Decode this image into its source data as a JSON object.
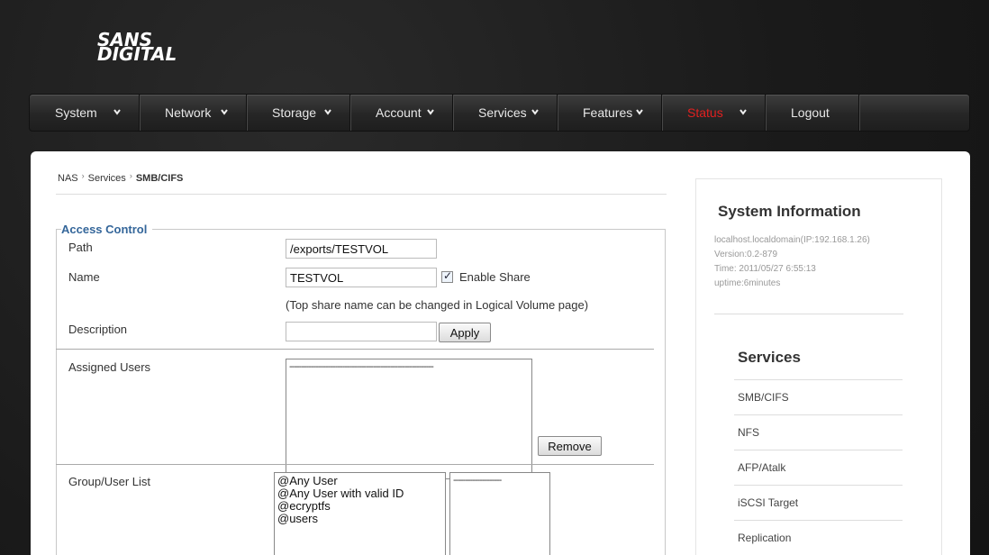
{
  "brand": {
    "line1": "SANS",
    "line2": "DIGITAL"
  },
  "nav": {
    "items": [
      {
        "label": "System",
        "width": 122
      },
      {
        "label": "Network",
        "width": 119
      },
      {
        "label": "Storage",
        "width": 115
      },
      {
        "label": "Account",
        "width": 114
      },
      {
        "label": "Services",
        "width": 116
      },
      {
        "label": "Features",
        "width": 116
      },
      {
        "label": "Status",
        "width": 115
      },
      {
        "label": "Logout",
        "width": 104
      }
    ]
  },
  "breadcrumb": {
    "root": "NAS",
    "mid": "Services",
    "current": "SMB/CIFS"
  },
  "access": {
    "legend": "Access Control",
    "path_label": "Path",
    "path_value": "/exports/TESTVOL",
    "name_label": "Name",
    "name_value": "TESTVOL",
    "enable_share": "Enable Share",
    "note": "(Top share name can be changed in Logical Volume page)",
    "description_label": "Description",
    "description_value": "",
    "apply": "Apply",
    "assigned_label": "Assigned Users",
    "assigned_placeholder": "------------------------------------------------------------",
    "remove": "Remove",
    "group_label": "Group/User List",
    "group_list": [
      "@Any User",
      "@Any User with valid ID",
      "@ecryptfs",
      "@users"
    ],
    "secondary_placeholder": "--------------------"
  },
  "sysinfo": {
    "title": "System Information",
    "host": "localhost.localdomain(IP:192.168.1.26)",
    "version": "Version:0.2-879",
    "time": "Time: 2011/05/27 6:55:13",
    "uptime": "uptime:6minutes"
  },
  "services": {
    "title": "Services",
    "items": [
      "SMB/CIFS",
      "NFS",
      "AFP/Atalk",
      "iSCSI Target",
      "Replication"
    ]
  }
}
